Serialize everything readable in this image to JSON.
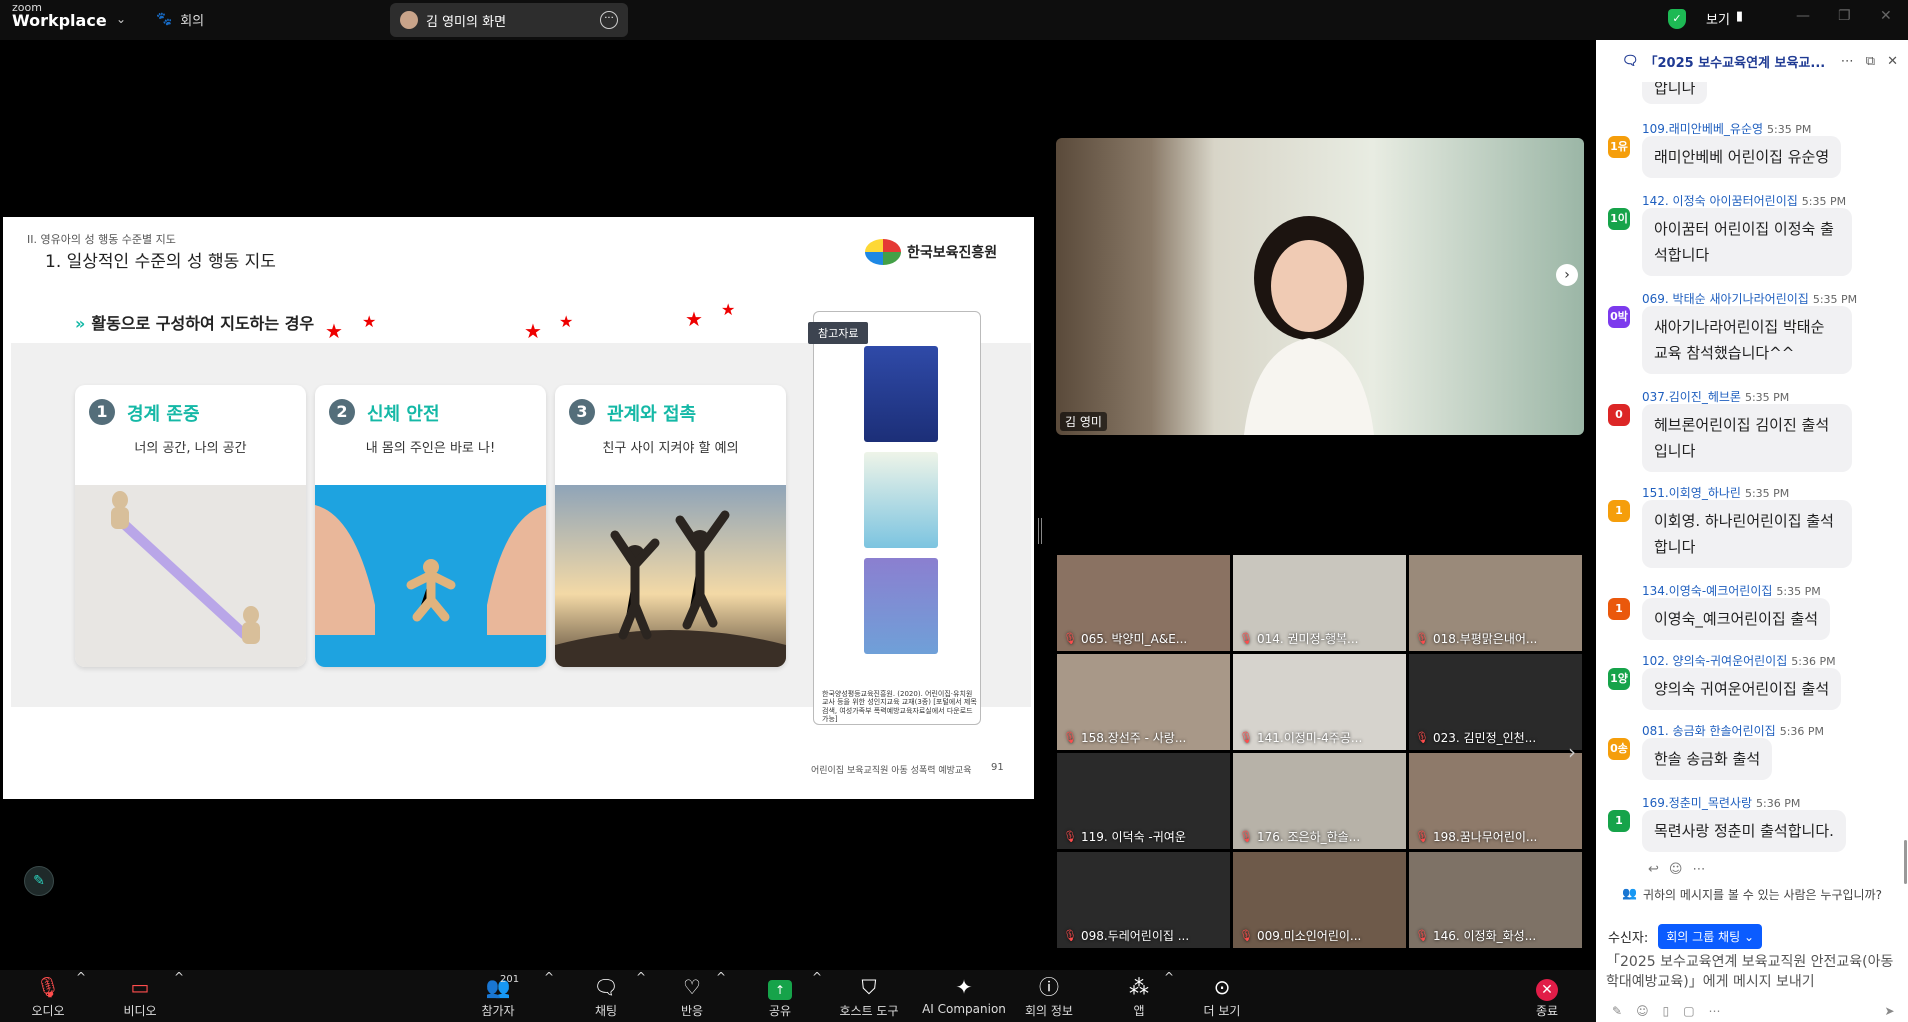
{
  "app": {
    "brand_top": "zoom",
    "brand_bottom": "Workplace",
    "meeting_label": "회의"
  },
  "share_pill": {
    "label": "김 영미의 화면"
  },
  "view": {
    "label": "보기"
  },
  "slide": {
    "section": "II. 영유아의 성 행동 수준별 지도",
    "heading": "1. 일상적인 수준의 성 행동 지도",
    "org": "한국보육진흥원",
    "subtitle": "활동으로 구성하여 지도하는 경우",
    "cards": [
      {
        "num": "1",
        "title": "경계 존중",
        "desc": "너의 공간, 나의 공간"
      },
      {
        "num": "2",
        "title": "신체 안전",
        "desc": "내 몸의 주인은 바로 나!"
      },
      {
        "num": "3",
        "title": "관계와 접촉",
        "desc": "친구 사이 지켜야 할 예의"
      }
    ],
    "ref_tag": "참고자료",
    "citation": "한국양성평등교육진흥원. (2020). 어린이집·유치원 교사 등을 위한 성인지교육 교재(3종) [포털에서 제목 검색, 여성가족부 폭력예방교육자료실에서 다운로드 가능]",
    "footer": "어린이집 보육교직원 아동 성폭력 예방교육",
    "page": "91"
  },
  "speaker": {
    "name": "김 영미"
  },
  "participants": [
    "065. 박양미_A&E...",
    "014. 권미정-행복...",
    "018.부평맑은내어...",
    "158.장선주 - 사랑...",
    "141.이정미-4주공...",
    "023. 김민정_인천...",
    "119. 이덕숙 -귀여운",
    "176. 조은하_한솔...",
    "198.꿈나무어린이...",
    "098.두레어린이집 ...",
    "009.미소인어린이...",
    "146. 이정화_화성..."
  ],
  "chat": {
    "title": "「2025 보수교육연계 보육교...",
    "top_fragment": "압니나",
    "messages": [
      {
        "avatar": "1유",
        "color": "#f59e0b",
        "sender": "109.래미안베베_유순영",
        "time": "5:35 PM",
        "text": "래미안베베 어린이집 유순영"
      },
      {
        "avatar": "1이",
        "color": "#16a34a",
        "sender": "142. 이정숙 아이꿈터어린이집",
        "time": "5:35 PM",
        "text": "아이꿈터 어린이집 이정숙 출석합니다"
      },
      {
        "avatar": "0박",
        "color": "#7c3aed",
        "sender": "069. 박태순 새아기나라어린이집",
        "time": "5:35 PM",
        "text": "새아기나라어린이집 박태순 교육 참석했습니다^^"
      },
      {
        "avatar": "0",
        "color": "#dc2626",
        "sender": "037.김이진_헤브론",
        "time": "5:35 PM",
        "text": "헤브론어린이집 김이진 출석입니다"
      },
      {
        "avatar": "1",
        "color": "#f59e0b",
        "sender": "151.이회영_하나린",
        "time": "5:35 PM",
        "text": "이회영. 하나린어린이집 출석합니다"
      },
      {
        "avatar": "1",
        "color": "#ea580c",
        "sender": "134.이영숙-예크어린이집",
        "time": "5:35 PM",
        "text": "이영숙_예크어린이집 출석"
      },
      {
        "avatar": "1양",
        "color": "#16a34a",
        "sender": "102. 양의숙-귀여운어린이집",
        "time": "5:36 PM",
        "text": "양의숙 귀여운어린이집 출석"
      },
      {
        "avatar": "0송",
        "color": "#f59e0b",
        "sender": "081. 송금화 한솔어린이집",
        "time": "5:36 PM",
        "text": "한솔 송금화 출석"
      },
      {
        "avatar": "1",
        "color": "#16a34a",
        "sender": "169.정춘미_목련사랑",
        "time": "5:36 PM",
        "text": "목련사랑 정춘미 출석합니다."
      }
    ],
    "visibility": "귀하의 메시지를 볼 수 있는 사람은 누구입니까?",
    "recipient_label": "수신자:",
    "recipient_value": "회의 그룹 채팅",
    "compose_placeholder": "「2025 보수교육연계 보육교직원 안전교육(아동학대예방교육)」에게 메시지 보내기"
  },
  "toolbar": {
    "audio": "오디오",
    "video": "비디오",
    "participants": "참가자",
    "participants_count": "201",
    "chat": "채팅",
    "reactions": "반응",
    "share": "공유",
    "host_tools": "호스트 도구",
    "ai": "AI Companion",
    "info": "회의 정보",
    "apps": "앱",
    "more": "더 보기",
    "end": "종료"
  }
}
